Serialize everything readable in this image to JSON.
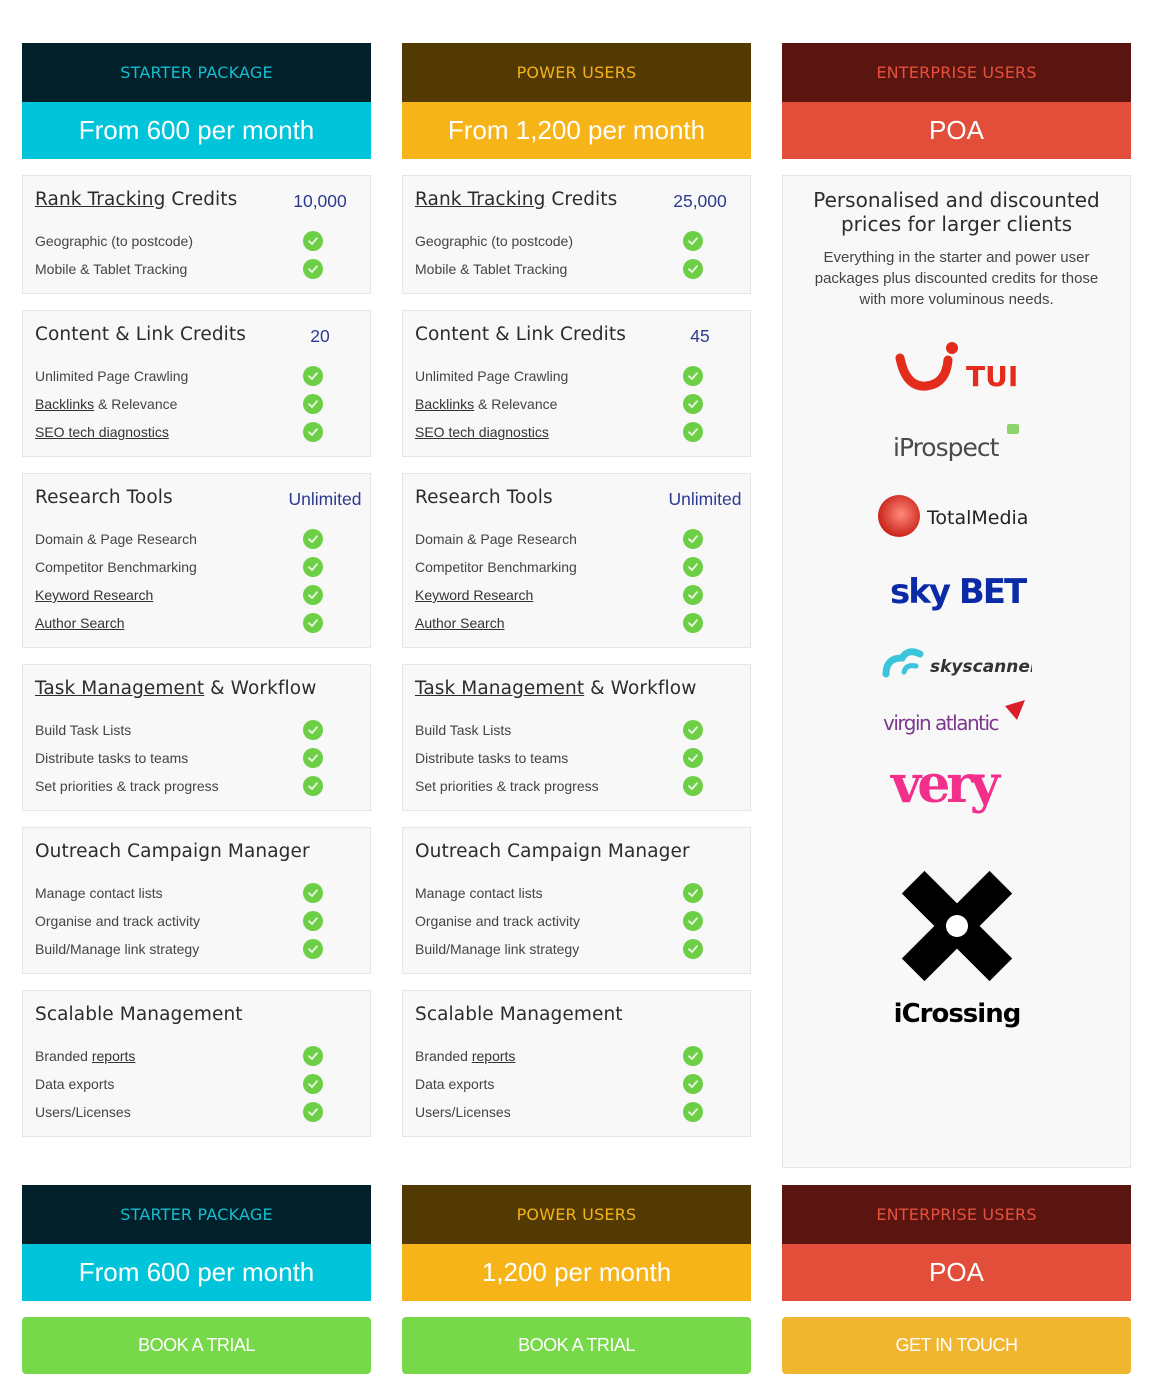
{
  "plans": [
    {
      "name": "STARTER PACKAGE",
      "price": "From 600 per month",
      "sections": [
        {
          "title_u": "Rank Tracking",
          "title_rest": " Credits",
          "value": "10,000",
          "features": [
            {
              "pre": "",
              "u": "",
              "post": "Geographic (to postcode)"
            },
            {
              "pre": "",
              "u": "",
              "post": "Mobile & Tablet Tracking"
            }
          ]
        },
        {
          "title_u": "",
          "title_rest": "Content & Link Credits",
          "value": "20",
          "features": [
            {
              "pre": "",
              "u": "",
              "post": "Unlimited Page Crawling"
            },
            {
              "pre": "",
              "u": "Backlinks",
              "post": " & Relevance"
            },
            {
              "pre": "",
              "u": "SEO tech diagnostics",
              "post": ""
            }
          ]
        },
        {
          "title_u": "",
          "title_rest": "Research Tools",
          "value": "Unlimited",
          "features": [
            {
              "pre": "",
              "u": "",
              "post": "Domain & Page Research"
            },
            {
              "pre": "",
              "u": "",
              "post": "Competitor Benchmarking"
            },
            {
              "pre": "",
              "u": "Keyword Research",
              "post": ""
            },
            {
              "pre": "",
              "u": "Author Search",
              "post": ""
            }
          ]
        },
        {
          "title_u": "Task Management",
          "title_rest": " & Workflow",
          "value": "",
          "features": [
            {
              "pre": "",
              "u": "",
              "post": "Build Task Lists"
            },
            {
              "pre": "",
              "u": "",
              "post": "Distribute tasks to teams"
            },
            {
              "pre": "",
              "u": "",
              "post": "Set priorities & track progress"
            }
          ]
        },
        {
          "title_u": "",
          "title_rest": "Outreach Campaign Manager",
          "value": "",
          "features": [
            {
              "pre": "",
              "u": "",
              "post": "Manage contact lists"
            },
            {
              "pre": "",
              "u": "",
              "post": "Organise and track activity"
            },
            {
              "pre": "",
              "u": "",
              "post": "Build/Manage link strategy"
            }
          ]
        },
        {
          "title_u": "",
          "title_rest": "Scalable Management",
          "value": "",
          "features": [
            {
              "pre": "Branded ",
              "u": "reports",
              "post": ""
            },
            {
              "pre": "",
              "u": "",
              "post": "Data exports"
            },
            {
              "pre": "",
              "u": "",
              "post": "Users/Licenses"
            }
          ]
        }
      ],
      "footer_name": "STARTER PACKAGE",
      "footer_price": "From 600 per month",
      "cta": "BOOK A TRIAL"
    },
    {
      "name": "POWER USERS",
      "price": "From 1,200 per month",
      "sections": [
        {
          "title_u": "Rank Tracking",
          "title_rest": " Credits",
          "value": "25,000",
          "features": [
            {
              "pre": "",
              "u": "",
              "post": "Geographic (to postcode)"
            },
            {
              "pre": "",
              "u": "",
              "post": "Mobile & Tablet Tracking"
            }
          ]
        },
        {
          "title_u": "",
          "title_rest": "Content & Link Credits",
          "value": "45",
          "features": [
            {
              "pre": "",
              "u": "",
              "post": "Unlimited Page Crawling"
            },
            {
              "pre": "",
              "u": "Backlinks",
              "post": " & Relevance"
            },
            {
              "pre": "",
              "u": "SEO tech diagnostics",
              "post": ""
            }
          ]
        },
        {
          "title_u": "",
          "title_rest": "Research Tools",
          "value": "Unlimited",
          "features": [
            {
              "pre": "",
              "u": "",
              "post": "Domain & Page Research"
            },
            {
              "pre": "",
              "u": "",
              "post": "Competitor Benchmarking"
            },
            {
              "pre": "",
              "u": "Keyword Research",
              "post": ""
            },
            {
              "pre": "",
              "u": "Author Search",
              "post": ""
            }
          ]
        },
        {
          "title_u": "Task Management",
          "title_rest": " & Workflow",
          "value": "",
          "features": [
            {
              "pre": "",
              "u": "",
              "post": "Build Task Lists"
            },
            {
              "pre": "",
              "u": "",
              "post": "Distribute tasks to teams"
            },
            {
              "pre": "",
              "u": "",
              "post": "Set priorities & track progress"
            }
          ]
        },
        {
          "title_u": "",
          "title_rest": "Outreach Campaign Manager",
          "value": "",
          "features": [
            {
              "pre": "",
              "u": "",
              "post": "Manage contact lists"
            },
            {
              "pre": "",
              "u": "",
              "post": "Organise and track activity"
            },
            {
              "pre": "",
              "u": "",
              "post": "Build/Manage link strategy"
            }
          ]
        },
        {
          "title_u": "",
          "title_rest": "Scalable Management",
          "value": "",
          "features": [
            {
              "pre": "Branded ",
              "u": "reports",
              "post": ""
            },
            {
              "pre": "",
              "u": "",
              "post": "Data exports"
            },
            {
              "pre": "",
              "u": "",
              "post": "Users/Licenses"
            }
          ]
        }
      ],
      "footer_name": "POWER USERS",
      "footer_price": "1,200 per month",
      "cta": "BOOK A TRIAL"
    },
    {
      "name": "ENTERPRISE USERS",
      "price": "POA",
      "headline": "Personalised and discounted prices for larger clients",
      "description": "Everything in the starter and power user packages plus discounted credits for those with more voluminous needs.",
      "logos": [
        "TUI",
        "iProspect",
        "TotalMedia",
        "sky BET",
        "skyscanner",
        "virgin atlantic",
        "very",
        "iCrossing"
      ],
      "footer_name": "ENTERPRISE USERS",
      "footer_price": "POA",
      "cta": "GET IN TOUCH"
    }
  ],
  "colors": {
    "starter_dark": "#02202a",
    "starter_accent": "#00c4da",
    "power_dark": "#533a03",
    "power_accent": "#f7b418",
    "enterprise_dark": "#5a1510",
    "enterprise_accent": "#e24e3a",
    "check": "#6ccf46",
    "cta_green": "#77d84a",
    "cta_amber": "#f0b630",
    "value_text": "#2c3a8f"
  }
}
